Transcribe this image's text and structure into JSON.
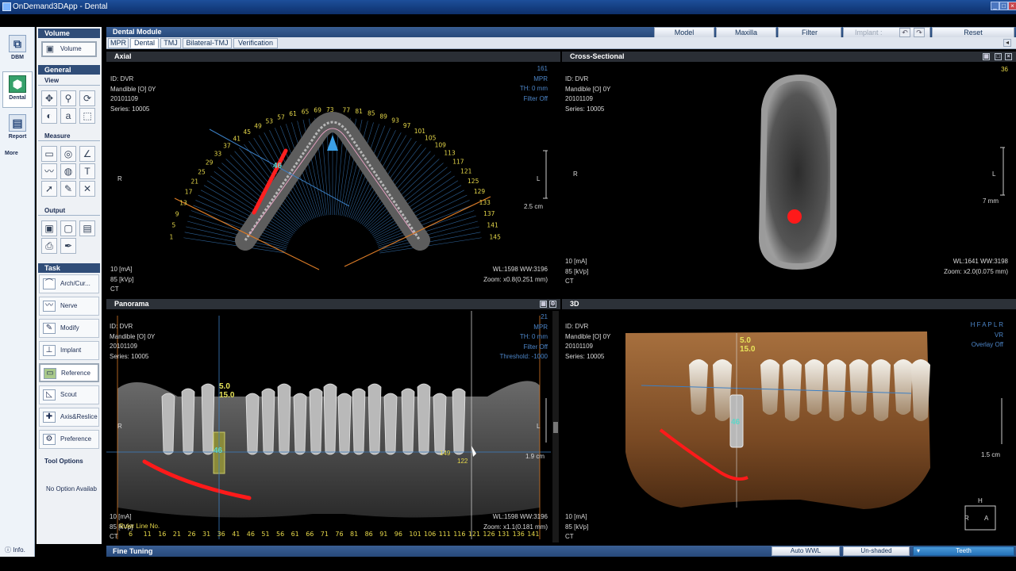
{
  "app": {
    "title": "OnDemand3DApp - Dental"
  },
  "left_strip": [
    {
      "label": "DBM",
      "icon": "database-icon",
      "glyph": "⧉"
    },
    {
      "label": "Dental",
      "icon": "tooth-cube-icon",
      "glyph": "⬢"
    },
    {
      "label": "Report",
      "icon": "printer-icon",
      "glyph": "▤"
    },
    {
      "label": "More",
      "icon": "more-icon",
      "glyph": ""
    }
  ],
  "tool_panel": {
    "volume_header": "Volume",
    "volume_button": "Volume",
    "general_header": "General",
    "view_header": "View",
    "measure_header": "Measure",
    "output_header": "Output",
    "task_header": "Task",
    "tasks": [
      {
        "label": "Arch/Cur...",
        "glyph": "⌒"
      },
      {
        "label": "Nerve",
        "glyph": "〰"
      },
      {
        "label": "Modify",
        "glyph": "✎"
      },
      {
        "label": "Implant",
        "glyph": "⊥"
      },
      {
        "label": "Reference",
        "glyph": "▭"
      },
      {
        "label": "Scout",
        "glyph": "◺"
      },
      {
        "label": "Axis&Reslice",
        "glyph": "✚"
      },
      {
        "label": "Preference",
        "glyph": "⚙"
      }
    ],
    "tool_options_header": "Tool Options",
    "no_option_text": "No Option Availab",
    "info_label": "Info."
  },
  "module": {
    "title": "Dental Module",
    "tabs": [
      "MPR",
      "Dental",
      "TMJ",
      "Bilateral-TMJ",
      "Verification"
    ],
    "active_tab": "Dental"
  },
  "toolbar": {
    "model": "Model",
    "maxilla": "Maxilla",
    "filter": "Filter",
    "implant": "Implant :",
    "reset": "Reset"
  },
  "views": {
    "axial": {
      "title": "Axial",
      "info": "ID: DVR\nMandible [O] 0Y\n20101109\nSeries: 10005",
      "top_right": "161\nMPR\nTH: 0 mm\nFilter Off",
      "bottom_left": "10 [mA]\n85 [kVp]\nCT",
      "bottom_right": "WL:1598 WW:3196\nZoom: x0.8(0.251 mm)",
      "scale": "2.5 cm",
      "orient_r": "R",
      "orient_l": "L",
      "marker": "46",
      "arch_numbers_left": [
        "1",
        "5",
        "9",
        "13",
        "17",
        "21",
        "25",
        "29",
        "33",
        "37",
        "41",
        "45",
        "49",
        "53",
        "57",
        "61",
        "65",
        "69",
        "73"
      ],
      "arch_numbers_right": [
        "77",
        "81",
        "85",
        "89",
        "93",
        "97",
        "101",
        "105",
        "109",
        "113",
        "117",
        "121",
        "125",
        "129",
        "133",
        "137",
        "141",
        "145"
      ]
    },
    "cross_sectional": {
      "title": "Cross-Sectional",
      "info": "ID: DVR\nMandible [O] 0Y\n20101109\nSeries: 10005",
      "top_right": "36",
      "bottom_left": "10 [mA]\n85 [kVp]\nCT",
      "bottom_right": "WL:1641 WW:3198\nZoom: x2.0(0.075 mm)",
      "scale": "7 mm",
      "orient_r": "R",
      "orient_l": "L"
    },
    "panorama": {
      "title": "Panorama",
      "info": "ID: DVR\nMandible [O] 0Y\n20101109\nSeries: 10005",
      "top_right": "21\nMPR\nTH: 0 mm\nFilter Off\nThreshold: -1000",
      "bottom_left": "10 [mA]\n85 [kVp]\nCT",
      "bottom_right": "WL:1598 WW:3196\nZoom: x1.1(0.181 mm)",
      "scale": "1.9 cm",
      "orient_r": "R",
      "orient_l": "L",
      "implant_label": "5.0\n15.0",
      "marker": "46",
      "pos_149": "149",
      "pos_122": "122",
      "ruler_label": "Ruler Line No.",
      "ruler_numbers": [
        "6",
        "11",
        "16",
        "21",
        "26",
        "31",
        "36",
        "41",
        "46",
        "51",
        "56",
        "61",
        "66",
        "71",
        "76",
        "81",
        "86",
        "91",
        "96",
        "101",
        "106",
        "111",
        "116",
        "121",
        "126",
        "131",
        "136",
        "141"
      ]
    },
    "three_d": {
      "title": "3D",
      "info": "ID: DVR\nMandible [O] 0Y\n20101109\nSeries: 10005",
      "top_right": "H F A P L R\nVR\nOverlay Off",
      "bottom_left": "10 [mA]\n85 [kVp]\nCT",
      "implant_label": "5.0\n15.0",
      "marker": "46",
      "scale": "1.5 cm",
      "orient_h": "H",
      "orient_r": "R",
      "orient_a": "A"
    }
  },
  "status": {
    "fine_tuning": "Fine Tuning",
    "auto_wwl": "Auto WWL",
    "unshaded": "Un-shaded",
    "teeth": "Teeth"
  }
}
